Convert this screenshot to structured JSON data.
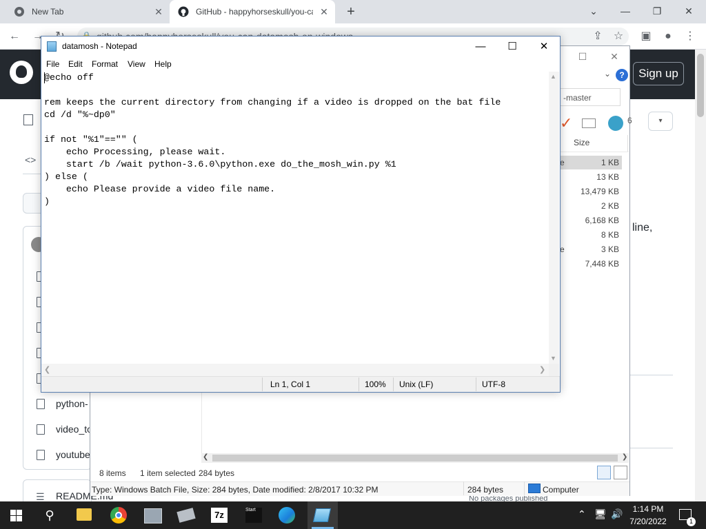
{
  "browser": {
    "tabs": [
      {
        "title": "New Tab",
        "active": false
      },
      {
        "title": "GitHub - happyhorseskull/you-ca",
        "active": true
      }
    ],
    "address": "github.com/happyhorseskull/you-can-datamosh-on-windows"
  },
  "github": {
    "signup_label": "Sign up",
    "files": [
      "python-",
      "video_to",
      "youtube"
    ],
    "readme": "README.md",
    "side_text": "line,",
    "packages_text": "No packages published"
  },
  "explorer": {
    "path_text": "-master",
    "column_size": "Size",
    "sizes": [
      "1 KB",
      "13 KB",
      "13,479 KB",
      "2 KB",
      "6,168 KB",
      "8 KB",
      "3 KB",
      "7,448 KB"
    ],
    "row_fragments": [
      "e",
      "e"
    ],
    "status_items": "8 items",
    "status_selected": "1 item selected",
    "status_bytes": "284 bytes",
    "details_type": "Type: Windows Batch File, Size: 284 bytes, Date modified: 2/8/2017 10:32 PM",
    "details_size": "284 bytes",
    "details_location": "Computer"
  },
  "notepad": {
    "title": "datamosh - Notepad",
    "menu": [
      "File",
      "Edit",
      "Format",
      "View",
      "Help"
    ],
    "content": "@echo off\n\nrem keeps the current directory from changing if a video is dropped on the bat file\ncd /d \"%~dp0\"\n\nif not \"%1\"==\"\" (\n    echo Processing, please wait.\n    start /b /wait python-3.6.0\\python.exe do_the_mosh_win.py %1\n) else (\n    echo Please provide a video file name.\n)",
    "status": {
      "position": "Ln 1, Col 1",
      "zoom": "100%",
      "line_endings": "Unix (LF)",
      "encoding": "UTF-8"
    }
  },
  "taskbar": {
    "apps": [
      "file-explorer",
      "chrome",
      "screenshot-tool",
      "keyboard-tool",
      "7-zip",
      "start-bat",
      "edge",
      "notepad"
    ],
    "label_7zip": "7z",
    "label_start": "Start",
    "time": "1:14 PM",
    "date": "7/20/2022",
    "notification_count": "1"
  },
  "colors": {
    "github_header": "#24292f",
    "taskbar": "#202020",
    "accent": "#76b9ed"
  }
}
